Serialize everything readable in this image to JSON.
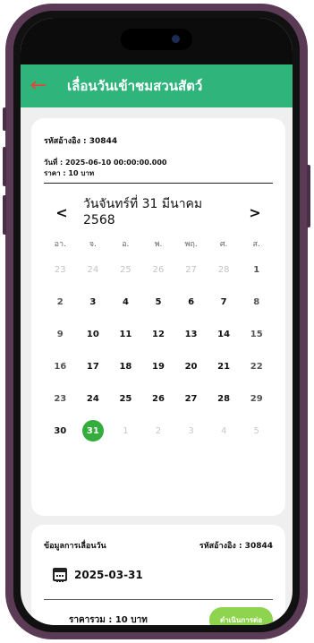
{
  "app": {
    "title": "เลื่อนวันเข้าชมสวนสัตว์",
    "back_icon": "arrow-left-icon",
    "accent": "#2fb57c"
  },
  "booking": {
    "ref": "รหัสอ้างอิง : 30844",
    "date": "วันที่ : 2025-06-10 00:00:00.000",
    "price": "ราคา : 10 บาท"
  },
  "calendar": {
    "month_line1": "วันจันทร์ที่ 31 มีนาคม",
    "month_line2": "2568",
    "prev": "<",
    "next": ">",
    "weekdays": [
      "อา.",
      "จ.",
      "อ.",
      "พ.",
      "พฤ.",
      "ศ.",
      "ส."
    ],
    "days": [
      "23",
      "24",
      "25",
      "26",
      "27",
      "28",
      "1",
      "2",
      "3",
      "4",
      "5",
      "6",
      "7",
      "8",
      "9",
      "10",
      "11",
      "12",
      "13",
      "14",
      "15",
      "16",
      "17",
      "18",
      "19",
      "20",
      "21",
      "22",
      "23",
      "24",
      "25",
      "26",
      "27",
      "28",
      "29",
      "30",
      "31",
      "1",
      "2",
      "3",
      "4",
      "5"
    ],
    "selected": "31"
  },
  "summary": {
    "heading": "ข้อมูลการเลื่อนวัน",
    "ref": "รหัสอ้างอิง : 30844",
    "new_date": "2025-03-31",
    "total": "ราคารวม : 10 บาท",
    "proceed": "ดำเนินการต่อ"
  }
}
